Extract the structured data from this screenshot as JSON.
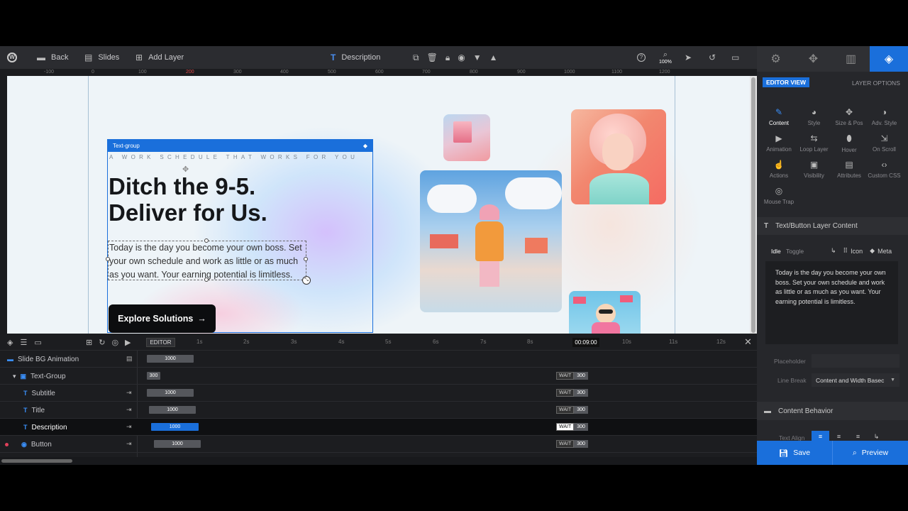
{
  "toolbar": {
    "back": "Back",
    "slides": "Slides",
    "add_layer": "Add Layer",
    "layer_name": "Description",
    "zoom": "100%"
  },
  "ruler": [
    "-100",
    "0",
    "100",
    "200",
    "300",
    "400",
    "500",
    "600",
    "700",
    "800",
    "900",
    "1000",
    "1100",
    "1200"
  ],
  "canvas": {
    "group_label": "Text-group",
    "subtitle": "A WORK SCHEDULE THAT WORKS FOR YOU",
    "title_line1": "Ditch the 9-5.",
    "title_line2": "Deliver for Us.",
    "description": "Today is the day you become your own boss. Set your own schedule and work as little or as much as you want. Your earning potential is limitless.",
    "button": "Explore Solutions"
  },
  "panel": {
    "editor_view": "EDITOR VIEW",
    "layer_options": "LAYER OPTIONS",
    "grid": [
      {
        "label": "Content",
        "icon": "pencil-icon",
        "glyph": "✎"
      },
      {
        "label": "Style",
        "icon": "palette-icon",
        "glyph": "◕"
      },
      {
        "label": "Size & Pos",
        "icon": "move-icon",
        "glyph": "✥"
      },
      {
        "label": "Adv. Style",
        "icon": "contrast-icon",
        "glyph": "◑"
      },
      {
        "label": "Animation",
        "icon": "play-icon",
        "glyph": "▶"
      },
      {
        "label": "Loop Layer",
        "icon": "loop-icon",
        "glyph": "⇆"
      },
      {
        "label": "Hover",
        "icon": "mouse-icon",
        "glyph": "⬮"
      },
      {
        "label": "On Scroll",
        "icon": "scroll-icon",
        "glyph": "⇲"
      },
      {
        "label": "Actions",
        "icon": "hand-icon",
        "glyph": "☝"
      },
      {
        "label": "Visibility",
        "icon": "visibility-icon",
        "glyph": "▣"
      },
      {
        "label": "Attributes",
        "icon": "document-icon",
        "glyph": "▤"
      },
      {
        "label": "Custom CSS",
        "icon": "code-icon",
        "glyph": "‹›"
      },
      {
        "label": "Mouse Trap",
        "icon": "target-icon",
        "glyph": "◎"
      }
    ],
    "section_title": "Text/Button Layer Content",
    "idle": "Idle",
    "toggle": "Toggle",
    "icon_btn": "Icon",
    "meta_btn": "Meta",
    "textarea": "Today is the day you become your own boss. Set your own schedule and work as little or as much as you want. Your earning potential is limitless.",
    "placeholder_label": "Placeholder",
    "linebreak_label": "Line Break",
    "linebreak_value": "Content and Width Basec",
    "behavior_title": "Content Behavior",
    "text_align": "Text Align",
    "save": "Save",
    "preview": "Preview"
  },
  "timeline": {
    "editor_tab": "EDITOR",
    "time_labels": [
      "1s",
      "2s",
      "3s",
      "4s",
      "5s",
      "6s",
      "7s",
      "8s",
      "10s",
      "11s",
      "12s"
    ],
    "current_time": "00:09:00",
    "rows": [
      {
        "name": "Slide BG Animation",
        "bar": "1000",
        "wait": "",
        "wait_val": ""
      },
      {
        "name": "Text-Group",
        "bar": "300",
        "wait": "WAIT",
        "wait_val": "300"
      },
      {
        "name": "Subtitle",
        "bar": "1000",
        "wait": "WAIT",
        "wait_val": "300"
      },
      {
        "name": "Title",
        "bar": "1000",
        "wait": "WAIT",
        "wait_val": "300"
      },
      {
        "name": "Description",
        "bar": "1000",
        "wait": "WAIT",
        "wait_val": "300"
      },
      {
        "name": "Button",
        "bar": "1000",
        "wait": "WAIT",
        "wait_val": "300"
      }
    ]
  }
}
